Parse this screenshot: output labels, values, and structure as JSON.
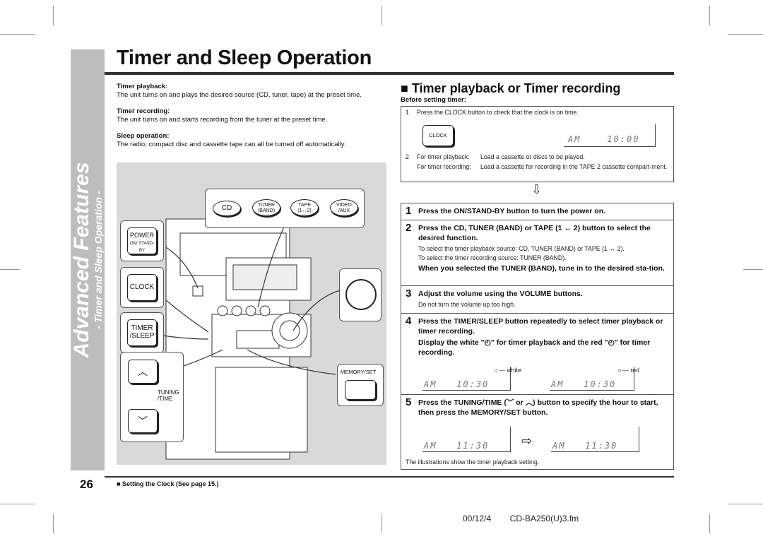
{
  "page": {
    "title": "Timer and Sleep Operation",
    "page_number": "26",
    "section": "Advanced Features",
    "subsection": "- Timer and Sleep Operation -",
    "see_also": "■ Setting the Clock (See page 15.)",
    "footer_date": "00/12/4",
    "footer_file": "CD-BA250(U)3.fm"
  },
  "intro": [
    {
      "heading": "Timer playback:",
      "text": "The unit turns on and plays the desired source (CD, tuner, tape) at the preset time."
    },
    {
      "heading": "Timer recording:",
      "text": "The unit turns on and starts recording from the tuner at the preset time."
    },
    {
      "heading": "Sleep operation:",
      "text": "The radio, compact disc and cassette tape can all be turned off automatically."
    }
  ],
  "illustration": {
    "sources": [
      {
        "label": "CD"
      },
      {
        "label": "TUNER",
        "sub": "(BAND)"
      },
      {
        "label": "TAPE",
        "sub": "(1↔2)"
      },
      {
        "label": "VIDEO",
        "sub": "/AUX"
      }
    ],
    "power": "POWER",
    "power_sub": "ON/ STAND-BY",
    "clock": "CLOCK",
    "timer": "TIMER",
    "timer2": "/SLEEP",
    "tuning": "TUNING",
    "tuning2": "/TIME",
    "memory": "MEMORY/SET",
    "up": "︿",
    "down": "﹀"
  },
  "right": {
    "heading": "■ Timer playback or Timer recording",
    "before": "Before setting timer:",
    "pre1": "Press the CLOCK button to check that the clock is on time.",
    "pre1_num": "1",
    "clock_btn": "CLOCK",
    "lcd1_am": "AM",
    "lcd1_time": "10:00",
    "pre2_num": "2",
    "pre2a_label": "For timer playback:",
    "pre2a": "Load a cassette or discs to be played.",
    "pre2b_label": "For timer recording:",
    "pre2b": "Load a cassette for recording in the TAPE 2 cassette compart-ment.",
    "steps": [
      {
        "num": "1",
        "head": "Press the ON/STAND-BY button to turn the power on."
      },
      {
        "num": "2",
        "head": "Press the CD, TUNER (BAND) or TAPE (1 ↔ 2) button to select the desired function.",
        "p1": "To select the timer playback source: CD, TUNER (BAND) or TAPE (1 ↔ 2).",
        "p2": "To select the timer recording source: TUNER (BAND).",
        "head2": "When you selected the TUNER (BAND), tune in to the desired sta-tion."
      },
      {
        "num": "3",
        "head": "Adjust the volume using the VOLUME buttons.",
        "p1": "Do not turn the volume up too high."
      },
      {
        "num": "4",
        "head": "Press the TIMER/SLEEP button repeatedly to select timer playback or timer recording.",
        "head2": "Display the white \"◴\" for timer playback and the red \"◴\" for timer recording.",
        "white": "white",
        "red": "red",
        "am": "AM",
        "time": "10:30"
      },
      {
        "num": "5",
        "head": "Press the TUNING/TIME (﹀ or ︿) button to specify the hour to start, then press the MEMORY/SET button.",
        "am": "AM",
        "time": "11:30",
        "note": "The illustrations show the timer playback setting."
      }
    ]
  }
}
